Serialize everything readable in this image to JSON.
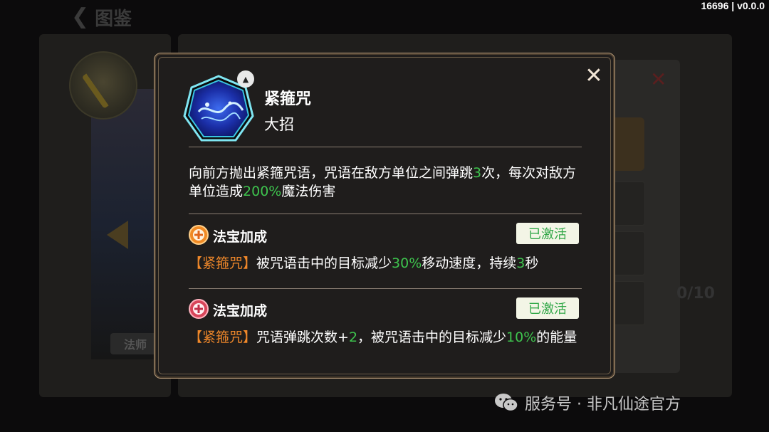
{
  "background": {
    "back_label": "图鉴",
    "role_tag": "法师",
    "counter": "0/10"
  },
  "version": "16696 | v0.0.0",
  "dialog": {
    "skill_name": "紧箍咒",
    "skill_type": "大招",
    "description": {
      "p1": "向前方抛出紧箍咒语，咒语在敌方单位之间弹跳",
      "n1": "3",
      "p2": "次，每次对敌方单位造成",
      "n2": "200%",
      "p3": "魔法伤害"
    },
    "bonuses": [
      {
        "title": "法宝加成",
        "status": "已激活",
        "icon": "orange-cross-medallion-icon",
        "desc": {
          "tag": "【紧箍咒】",
          "p1": "被咒语击中的目标减少",
          "n1": "30%",
          "p2": "移动速度，持续",
          "n2": "3",
          "p3": "秒"
        }
      },
      {
        "title": "法宝加成",
        "status": "已激活",
        "icon": "red-cross-medallion-icon",
        "desc": {
          "tag": "【紧箍咒】",
          "p1": "咒语弹跳次数+",
          "n1": "2",
          "p2": "，被咒语击中的目标减少",
          "n2": "10%",
          "p3": "的能量"
        }
      }
    ]
  },
  "watermark": {
    "text": "服务号 · 非凡仙途官方"
  },
  "colors": {
    "highlight_number": "#3ec44e",
    "tag_orange": "#f0882a",
    "dialog_border": "#b59a78",
    "badge_bg": "#f3f5e6",
    "badge_text": "#32a848"
  }
}
